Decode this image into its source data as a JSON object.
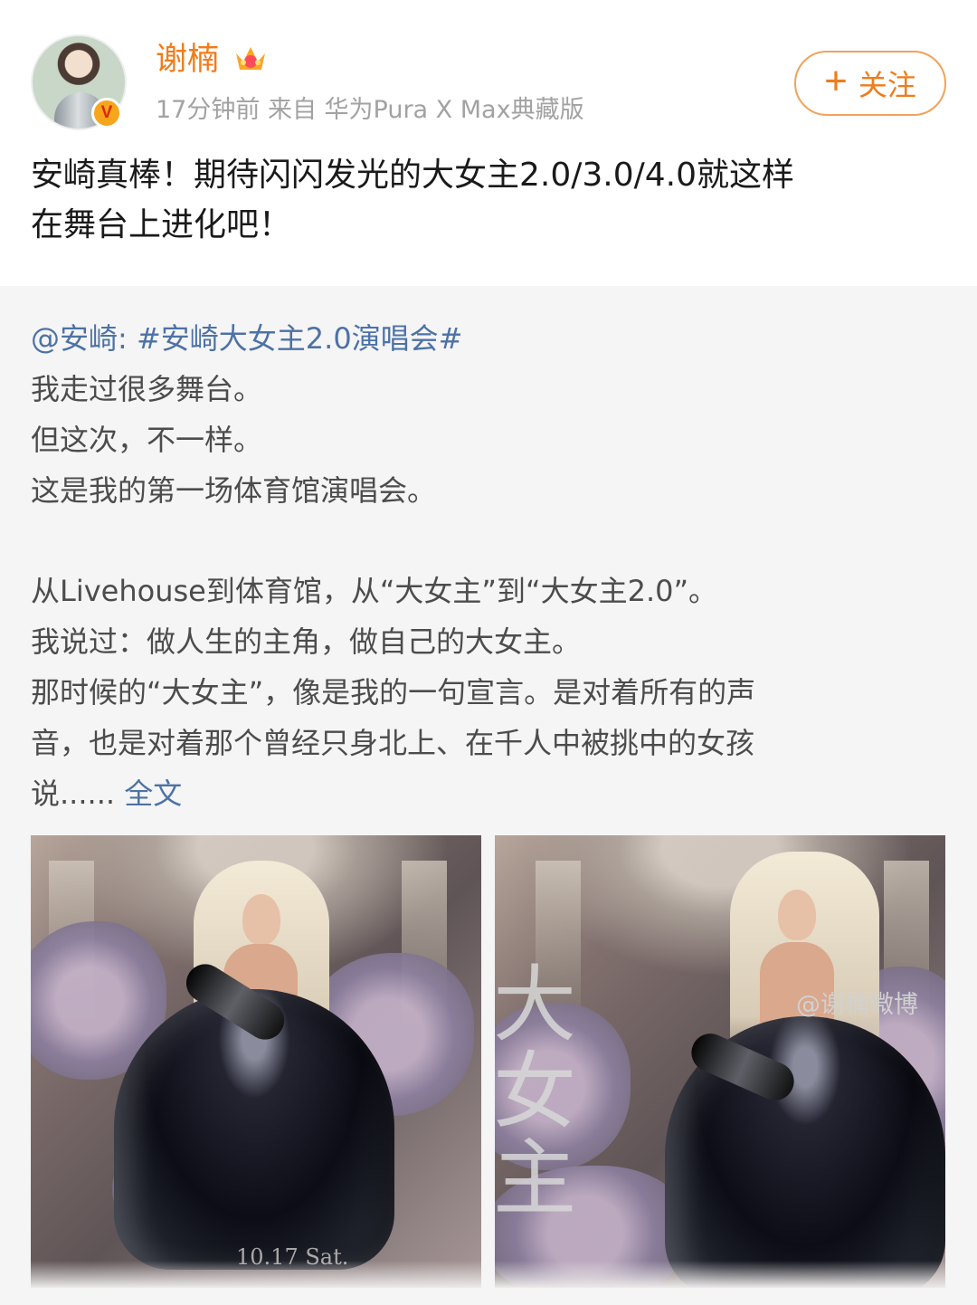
{
  "header": {
    "username": "谢楠",
    "meta": "17分钟前 来自 华为Pura X Max典藏版",
    "follow_label": "关注",
    "verified_label": "V"
  },
  "post": {
    "lines": [
      "安崎真棒！期待闪闪发光的大女主2.0/3.0/4.0就这样",
      "在舞台上进化吧！"
    ]
  },
  "repost": {
    "mention": "@安崎:",
    "topic": "#安崎大女主2.0演唱会#",
    "lines": [
      "我走过很多舞台。",
      "但这次，不一样。",
      "这是我的第一场体育馆演唱会。",
      "从Livehouse到体育馆，从“大女主”到“大女主2.0”。",
      "我说过：做人生的主角，做自己的大女主。",
      "那时候的“大女主”，像是我的一句宣言。是对着所有的声",
      "音，也是对着那个曾经只身北上、在千人中被挑中的女孩",
      "说......"
    ],
    "full_text_link": "全文"
  },
  "images": {
    "poster_title": "大女主",
    "date_text": "10.17 Sat."
  },
  "watermark": "@谢楠微博"
}
